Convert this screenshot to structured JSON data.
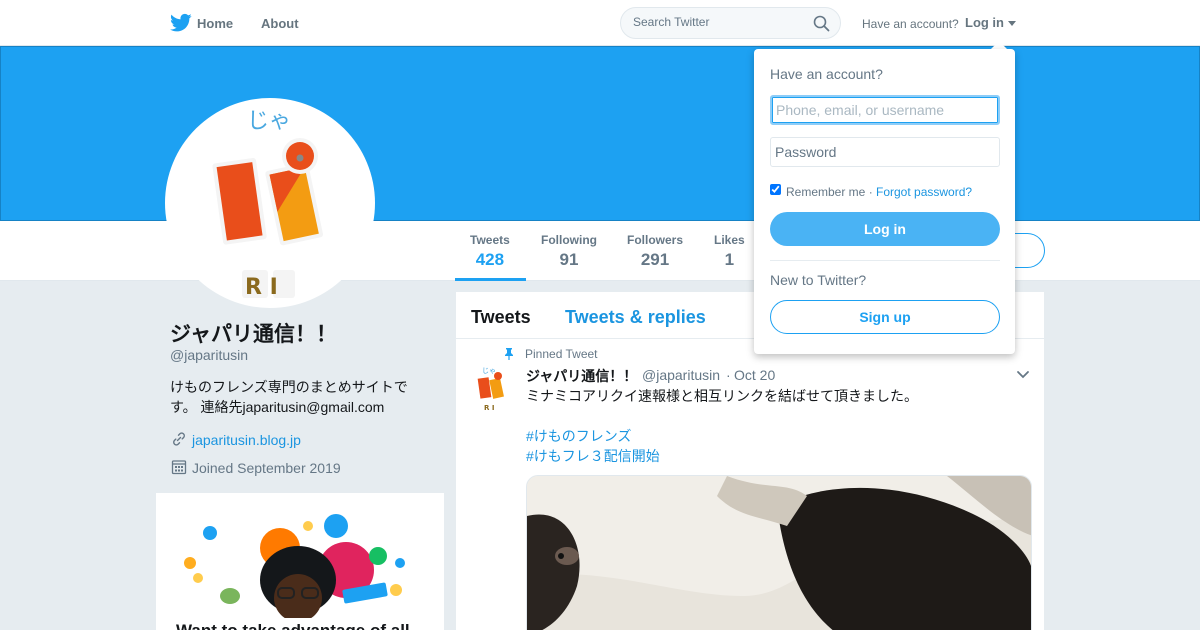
{
  "colors": {
    "brand": "#1da1f2",
    "link": "#1b95e0",
    "text": "#14171a",
    "muted": "#657786",
    "background": "#e6ecf0"
  },
  "topbar": {
    "logo_icon": "twitter-bird-icon",
    "home_label": "Home",
    "about_label": "About",
    "search_placeholder": "Search Twitter",
    "search_icon": "search-icon",
    "have_account": "Have an account?",
    "login_label": "Log in",
    "caret_icon": "chevron-down-icon"
  },
  "profile": {
    "name": "ジャパリ通信！！",
    "handle": "@japaritusin",
    "bio": "けものフレンズ専門のまとめサイトです。 連絡先japaritusin@gmail.com",
    "link_icon": "link-icon",
    "link": "japaritusin.blog.jp",
    "joined_icon": "calendar-icon",
    "joined": "Joined September 2019",
    "avatar_kana": "じゃ",
    "avatar_letters": "R I"
  },
  "stats": [
    {
      "label": "Tweets",
      "value": "428",
      "active": true
    },
    {
      "label": "Following",
      "value": "91",
      "active": false
    },
    {
      "label": "Followers",
      "value": "291",
      "active": false
    },
    {
      "label": "Likes",
      "value": "1",
      "active": false
    }
  ],
  "promo": {
    "text": "Want to take advantage of all"
  },
  "timeline": {
    "tabs": [
      "Tweets",
      "Tweets & replies"
    ],
    "active_tab": "Tweets",
    "pinned_icon": "pin-icon",
    "pinned_label": "Pinned Tweet",
    "tweet": {
      "name": "ジャパリ通信！！",
      "handle": "@japaritusin",
      "separator": "·",
      "date": "Oct 20",
      "text": "ミナミコアリクイ速報様と相互リンクを結ばせて頂きました。",
      "hashtags": [
        "#けものフレンズ",
        "#けもフレ３配信開始"
      ],
      "menu_icon": "chevron-down-icon",
      "media": "tamandua-photo"
    }
  },
  "login_dropdown": {
    "title": "Have an account?",
    "username_placeholder": "Phone, email, or username",
    "password_placeholder": "Password",
    "remember_label": "Remember me · ",
    "remember_checked": true,
    "forgot_label": "Forgot password?",
    "login_button": "Log in",
    "new_label": "New to Twitter?",
    "signup_button": "Sign up"
  }
}
